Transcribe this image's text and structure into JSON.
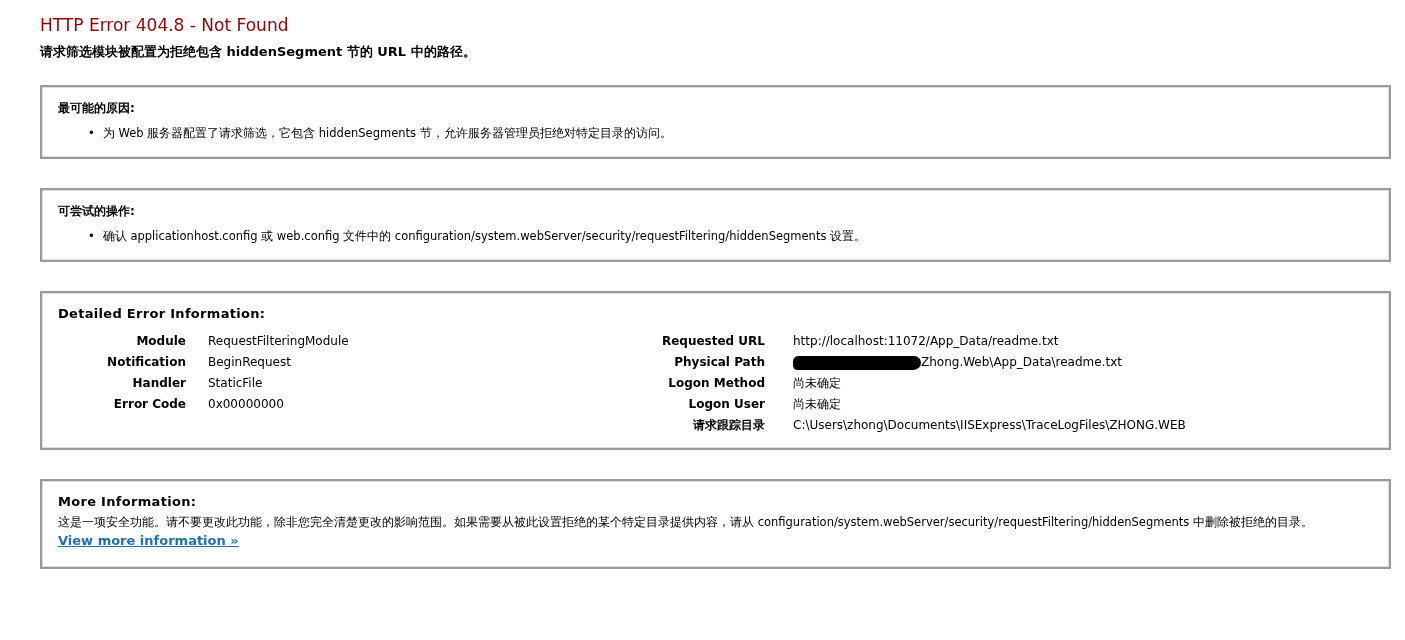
{
  "title": "HTTP Error 404.8 - Not Found",
  "subtitle": "请求筛选模块被配置为拒绝包含 hiddenSegment 节的 URL 中的路径。",
  "sections": [
    {
      "kind": "list",
      "heading": "最可能的原因:",
      "items": [
        {
          "bullet": "•",
          "text": "为 Web 服务器配置了请求筛选，它包含 hiddenSegments 节，允许服务器管理员拒绝对特定目录的访问。"
        }
      ]
    },
    {
      "kind": "list",
      "heading": "可尝试的操作:",
      "items": [
        {
          "bullet": "•",
          "text": "确认 applicationhost.config 或 web.config 文件中的 configuration/system.webServer/security/requestFiltering/hiddenSegments 设置。"
        }
      ]
    },
    {
      "kind": "details",
      "heading": "Detailed Error Information:",
      "left": [
        {
          "label": "Module",
          "value": "RequestFilteringModule"
        },
        {
          "label": "Notification",
          "value": "BeginRequest"
        },
        {
          "label": "Handler",
          "value": "StaticFile"
        },
        {
          "label": "Error Code",
          "value": "0x00000000"
        }
      ],
      "right": [
        {
          "label": "Requested URL",
          "value": "http://localhost:11072/App_Data/readme.txt",
          "redacted": false
        },
        {
          "label": "Physical Path",
          "value": "Zhong.Web\\App_Data\\readme.txt",
          "redacted": true
        },
        {
          "label": "Logon Method",
          "value": "尚未确定",
          "redacted": false
        },
        {
          "label": "Logon User",
          "value": "尚未确定",
          "redacted": false
        },
        {
          "label": "请求跟踪目录",
          "value": "C:\\Users\\zhong\\Documents\\IISExpress\\TraceLogFiles\\ZHONG.WEB",
          "redacted": false
        }
      ]
    },
    {
      "kind": "text",
      "heading": "More Information:",
      "text": "这是一项安全功能。请不要更改此功能，除非您完全清楚更改的影响范围。如果需要从被此设置拒绝的某个特定目录提供内容，请从 configuration/system.webServer/security/requestFiltering/hiddenSegments 中删除被拒绝的目录。",
      "link": "View more information »"
    }
  ]
}
